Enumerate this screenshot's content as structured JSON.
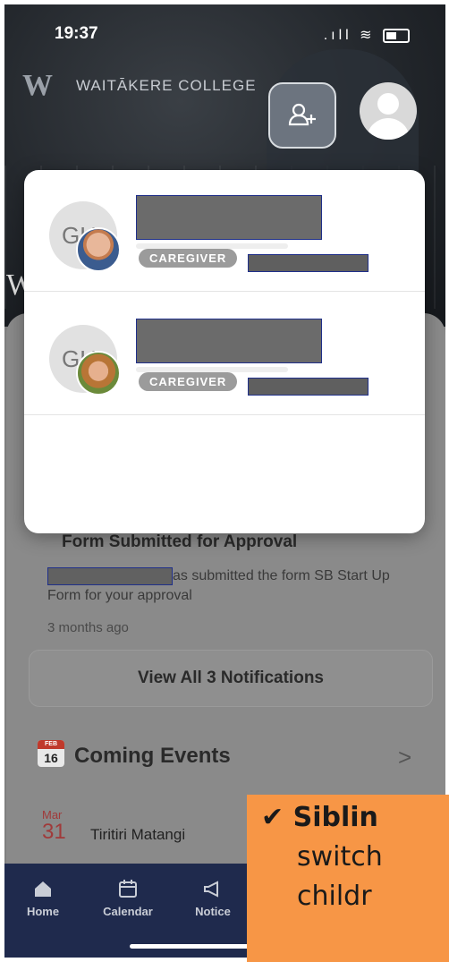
{
  "status_bar": {
    "time": "19:37",
    "signal": ".ıll",
    "wifi": "≋"
  },
  "header": {
    "school_name": "WAITĀKERE COLLEGE"
  },
  "background": {
    "w_letter": "W"
  },
  "account_switcher": {
    "accounts": [
      {
        "initials": "GH",
        "role_badge": "CAREGIVER"
      },
      {
        "initials": "GH",
        "role_badge": "CAREGIVER"
      }
    ]
  },
  "notification": {
    "title": "Form Submitted for Approval",
    "body_suffix": "as submitted the form SB Start Up Form for your approval",
    "time": "3 months ago"
  },
  "view_all_label": "View All 3 Notifications",
  "events": {
    "calendar_icon_month": "FEB",
    "calendar_icon_day": "16",
    "title": "Coming Events",
    "chevron": ">",
    "items": [
      {
        "month": "Mar",
        "day": "31",
        "name": "Tiritiri Matangi"
      }
    ]
  },
  "tabbar": {
    "items": [
      {
        "label": "Home",
        "icon": "home-icon"
      },
      {
        "label": "Calendar",
        "icon": "calendar-icon"
      },
      {
        "label": "Notice",
        "icon": "megaphone-icon"
      }
    ]
  },
  "callout": {
    "check": "✔",
    "line1": "Siblin",
    "line2": "switch",
    "line3": "childr"
  },
  "colors": {
    "tabbar": "#1f2a4d",
    "callout": "#f79646",
    "badge": "#9b9b9b",
    "event_accent": "#a03a3a"
  }
}
